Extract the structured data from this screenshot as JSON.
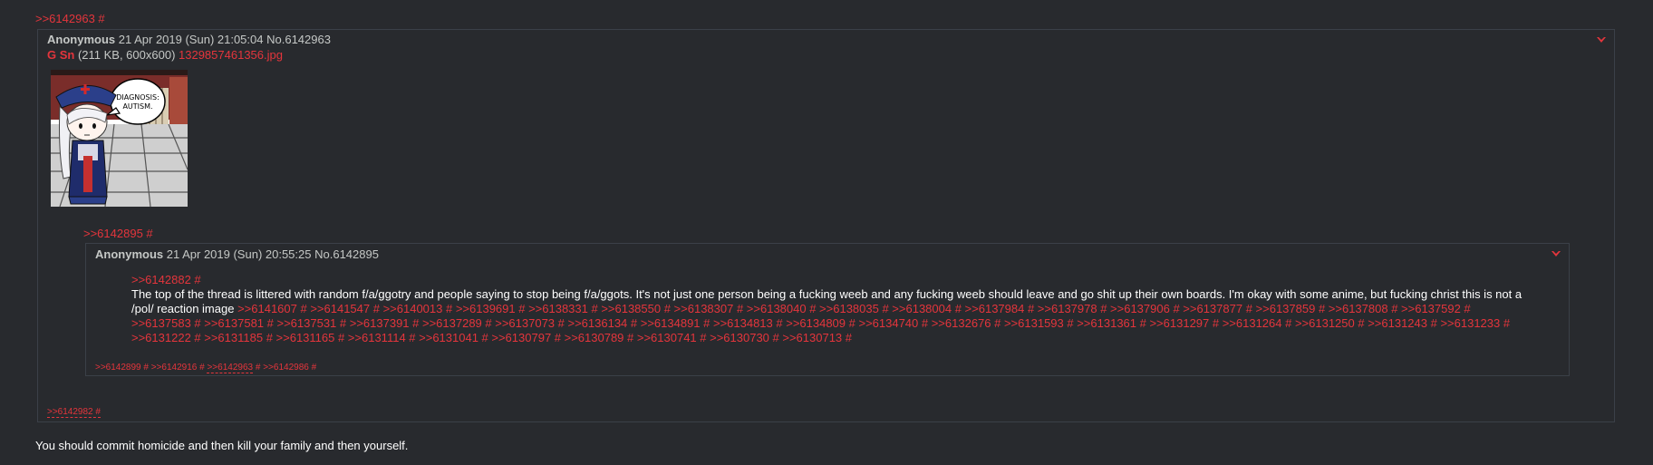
{
  "root_quote": ">>6142963 #",
  "outer_post": {
    "name": "Anonymous",
    "datetime": "21 Apr 2019 (Sun) 21:05:04",
    "post_no": "No.6142963",
    "file": {
      "gsn": "G Sn",
      "meta": " (211 KB, 600x600) ",
      "filename": "1329857461356.jpg",
      "thumb_text_line1": "DIAGNOSIS:",
      "thumb_text_line2": "AUTISM."
    },
    "inline_quote": ">>6142895 #",
    "backlink": ">>6142982 #"
  },
  "inner_post": {
    "name": "Anonymous",
    "datetime": "21 Apr 2019 (Sun) 20:55:25",
    "post_no": "No.6142895",
    "quote": ">>6142882 #",
    "body": "The top of the thread is littered with random f/a/ggotry and people saying to stop being f/a/ggots. It's not just one person being a fucking weeb and any fucking weeb should leave and go shit up their own boards. I'm okay with some anime, but fucking christ this is not a /pol/ reaction image ",
    "reply_links": ">>6141607 # >>6141547 # >>6140013 # >>6139691 # >>6138331 # >>6138550 # >>6138307 # >>6138040 # >>6138035 # >>6138004 # >>6137984 # >>6137978 # >>6137906 # >>6137877 # >>6137859 # >>6137808 # >>6137592 # >>6137583 # >>6137581 # >>6137531 # >>6137391 # >>6137289 # >>6137073 # >>6136134 # >>6134891 # >>6134813 # >>6134809 # >>6134740 # >>6132676 # >>6131593 # >>6131361 # >>6131297 # >>6131264 # >>6131250 # >>6131243 # >>6131233 # >>6131222 # >>6131185 # >>6131165 # >>6131114 # >>6131041 # >>6130797 # >>6130789 # >>6130741 # >>6130730 # >>6130713 #",
    "backlinks": {
      "b1": ">>6142899 #",
      "b2": ">>6142916 #",
      "b3": ">>6142963",
      "b3_hash": " #",
      "b4": ">>6142986 #"
    }
  },
  "final_message": "You should commit homicide and then kill your family and then yourself.",
  "colors": {
    "background": "#282a2e",
    "link": "#e4353c",
    "border": "#3b4048",
    "text": "#c5c8c6"
  }
}
